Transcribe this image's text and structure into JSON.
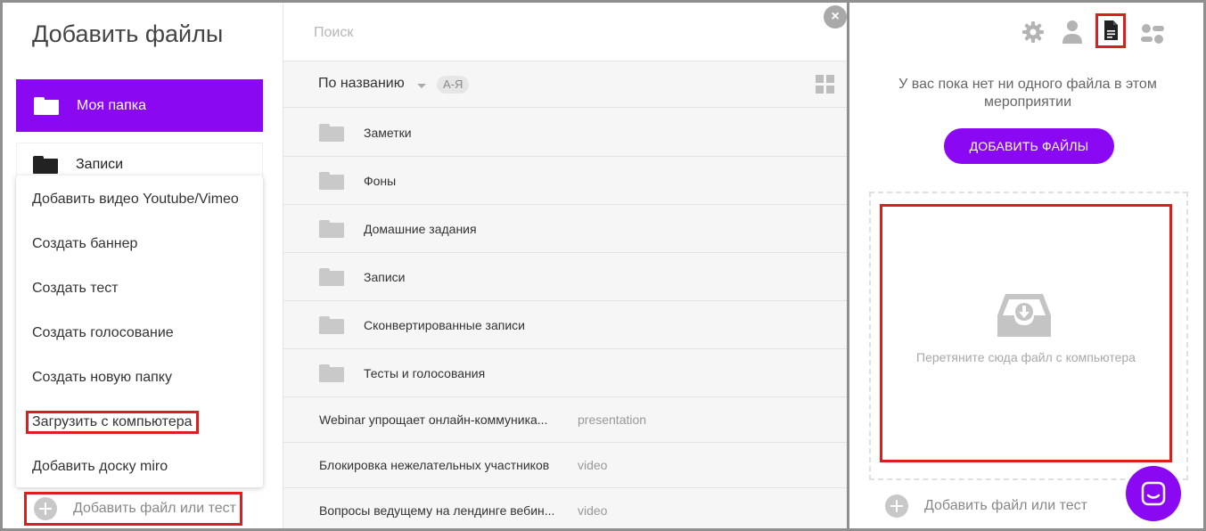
{
  "left": {
    "title": "Добавить файлы",
    "my_folder": "Моя папка",
    "records": "Записи",
    "menu": [
      "Добавить видео Youtube/Vimeo",
      "Создать баннер",
      "Создать тест",
      "Создать голосование",
      "Создать новую папку",
      "Загрузить с компьютера",
      "Добавить доску miro"
    ],
    "add_button": "Добавить файл или тест"
  },
  "middle": {
    "search_placeholder": "Поиск",
    "close_glyph": "×",
    "sort_label": "По названию",
    "sort_order": "А-Я",
    "folders": [
      "Заметки",
      "Фоны",
      "Домашние задания",
      "Записи",
      "Сконвертированные записи",
      "Тесты и голосования"
    ],
    "files": [
      {
        "name": "Webinar упрощает онлайн-коммуника...",
        "type": "presentation"
      },
      {
        "name": "Блокировка нежелательных участников",
        "type": "video"
      },
      {
        "name": "Вопросы ведущему на лендинге вебин...",
        "type": "video"
      }
    ]
  },
  "right": {
    "empty_message": "У вас пока нет ни одного файла в этом мероприятии",
    "add_files_button": "ДОБАВИТЬ ФАЙЛЫ",
    "dropzone_text": "Перетяните сюда файл с компьютера",
    "add_button": "Добавить файл или тест",
    "icons": [
      "gear-icon",
      "user-icon",
      "file-icon",
      "settings-toggle-icon"
    ]
  },
  "colors": {
    "accent": "#8a09f2",
    "highlight": "#d9201f",
    "panel_bg": "#f6f6f6"
  }
}
